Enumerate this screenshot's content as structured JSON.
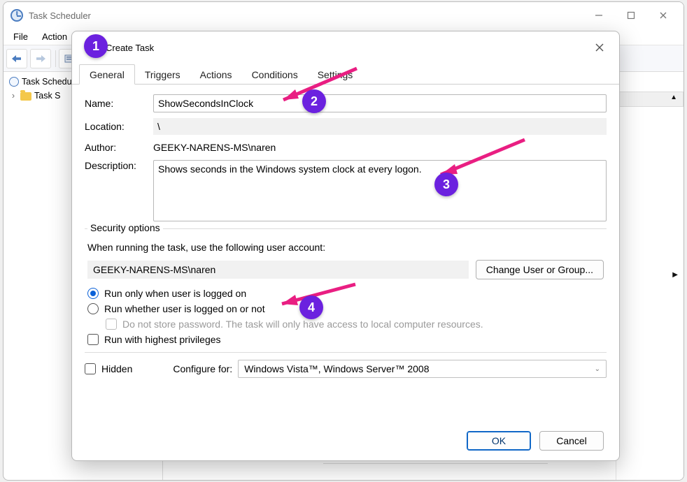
{
  "main_window": {
    "title": "Task Scheduler",
    "back_icon": "back",
    "fwd_icon": "forward",
    "menu": {
      "file": "File",
      "action": "Action"
    },
    "tree": {
      "root": "Task Scheduler",
      "lib": "Task S"
    }
  },
  "dialog": {
    "title": "Create Task",
    "tabs": {
      "general": "General",
      "triggers": "Triggers",
      "actions": "Actions",
      "conditions": "Conditions",
      "settings": "Settings"
    },
    "labels": {
      "name": "Name:",
      "location": "Location:",
      "author": "Author:",
      "description": "Description:"
    },
    "values": {
      "name": "ShowSecondsInClock",
      "location": "\\",
      "author": "GEEKY-NARENS-MS\\naren",
      "description": "Shows seconds in the Windows system clock at every logon."
    },
    "security": {
      "legend": "Security options",
      "when_running": "When running the task, use the following user account:",
      "account": "GEEKY-NARENS-MS\\naren",
      "change_btn": "Change User or Group...",
      "run_logged_on": "Run only when user is logged on",
      "run_whether": "Run whether user is logged on or not",
      "no_store_pw": "Do not store password.  The task will only have access to local computer resources.",
      "highest_priv": "Run with highest privileges"
    },
    "hidden_label": "Hidden",
    "configure_label": "Configure for:",
    "configure_value": "Windows Vista™, Windows Server™ 2008",
    "ok": "OK",
    "cancel": "Cancel"
  },
  "annotations": {
    "b1": "1",
    "b2": "2",
    "b3": "3",
    "b4": "4"
  }
}
